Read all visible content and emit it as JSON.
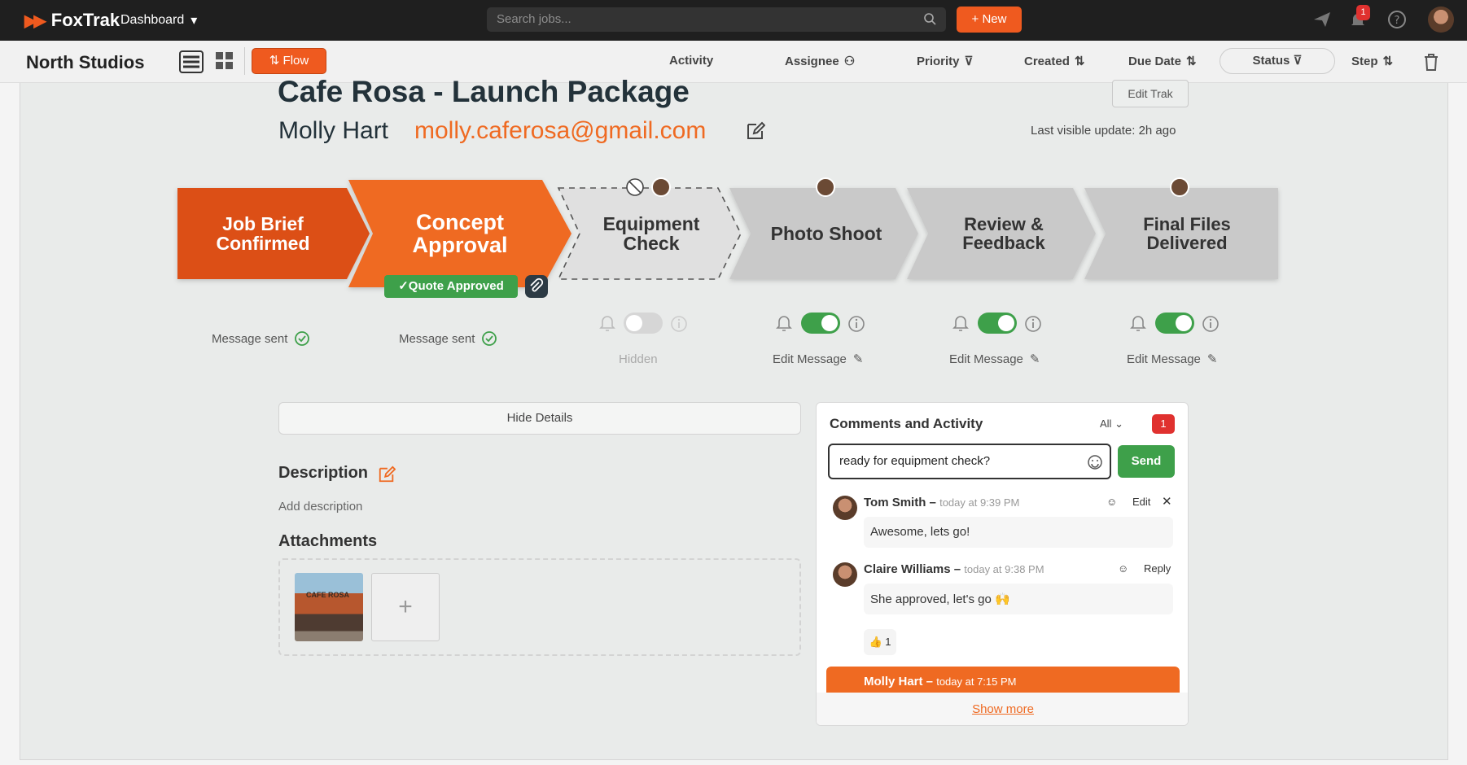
{
  "app": {
    "logo_text": "FoxTrak",
    "menu_label": "Dashboard",
    "search_placeholder": "Search jobs...",
    "new_label": "+ New",
    "notification_count": "1"
  },
  "toolbar": {
    "studio_name": "North Studios",
    "flow_label": "Flow",
    "columns": [
      "Activity",
      "Assignee",
      "Priority",
      "Created",
      "Due Date",
      "Status",
      "Step"
    ]
  },
  "job": {
    "title": "Cafe Rosa - Launch Package",
    "client_name": "Molly Hart",
    "client_email": "molly.caferosa@gmail.com",
    "edit_label": "Edit Trak",
    "last_update": "Last visible update: 2h ago"
  },
  "steps": [
    {
      "label_line1": "Job Brief",
      "label_line2": "Confirmed",
      "state": "done",
      "status_text": "Message sent"
    },
    {
      "label_line1": "Concept Approval",
      "label_line2": "",
      "state": "active",
      "status_text": "Message sent",
      "tag": "✓Quote Approved"
    },
    {
      "label_line1": "Equipment Check",
      "label_line2": "",
      "state": "hidden",
      "status_text": "Hidden"
    },
    {
      "label_line1": "Photo Shoot",
      "label_line2": "",
      "state": "pending",
      "status_text": "Edit Message"
    },
    {
      "label_line1": "Review &",
      "label_line2": "Feedback",
      "state": "pending",
      "status_text": "Edit Message"
    },
    {
      "label_line1": "Final Files",
      "label_line2": "Delivered",
      "state": "pending",
      "status_text": "Edit Message"
    }
  ],
  "details": {
    "hide_label": "Hide Details",
    "description_heading": "Description",
    "description_placeholder": "Add description",
    "attachments_heading": "Attachments",
    "attachment_image_text": "CAFE ROSA"
  },
  "comments": {
    "title": "Comments and Activity",
    "filter": "All",
    "count": "1",
    "input_value": "ready for equipment check?",
    "send_label": "Send",
    "items": [
      {
        "author": "Tom Smith",
        "time": "today at 9:39 PM",
        "body": "Awesome, lets go!",
        "actions": [
          "Edit"
        ]
      },
      {
        "author": "Claire Williams",
        "time": "today at 9:38 PM",
        "body": "She approved, let's go 🙌",
        "actions": [
          "Reply"
        ],
        "reaction": "👍 1"
      },
      {
        "author": "Molly Hart",
        "time": "today at 7:15 PM"
      }
    ],
    "show_more": "Show more"
  },
  "colors": {
    "brand": "#ef5a1f",
    "success": "#3ea04a",
    "danger": "#e0312f"
  }
}
